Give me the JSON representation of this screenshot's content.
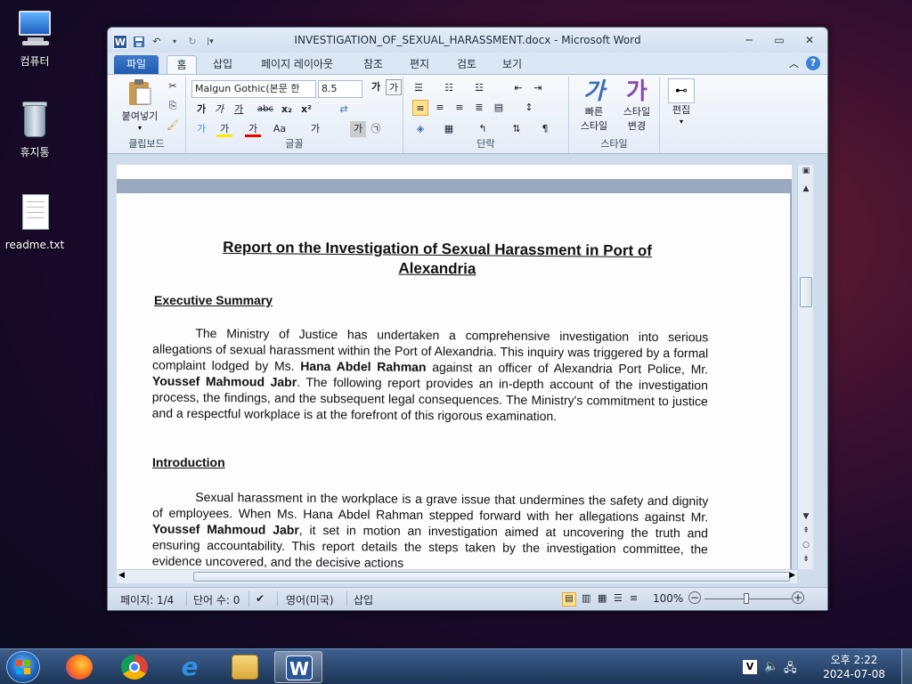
{
  "desktop": {
    "icons": [
      {
        "label": "컴퓨터"
      },
      {
        "label": "휴지통"
      },
      {
        "label": "readme.txt"
      }
    ]
  },
  "window": {
    "title": "INVESTIGATION_OF_SEXUAL_HARASSMENT.docx  -  Microsoft Word",
    "logo": "W",
    "controls": {
      "minimize": "─",
      "restore": "▭",
      "close": "✕"
    }
  },
  "tabs": {
    "file": "파일",
    "home": "홈",
    "insert": "삽입",
    "layout": "페이지 레이아웃",
    "references": "참조",
    "mailings": "편지",
    "review": "검토",
    "view": "보기",
    "help": "?"
  },
  "ribbon": {
    "clipboard": {
      "paste": "붙여넣기",
      "label": "클립보드"
    },
    "font": {
      "name": "Malgun Gothic(본문 한",
      "size": "8.5",
      "label": "글꼴",
      "bold": "가",
      "italic": "가",
      "underline": "가",
      "strike": "abc",
      "sub": "x₂",
      "sup": "x²",
      "highlight": "가",
      "color": "가",
      "case": "Aa",
      "grow": "가",
      "shrink": "가",
      "clear": "가",
      "phonetic": "가",
      "circle": "㉠"
    },
    "paragraph": {
      "label": "단락"
    },
    "styles": {
      "quick": "빠른\n스타일",
      "quick1": "빠른",
      "quick2": "스타일",
      "change1": "스타일",
      "change2": "변경",
      "label": "스타일",
      "glyph1": "가",
      "glyph2": "가"
    },
    "editing": {
      "label": "편집"
    }
  },
  "document": {
    "title_line1": "Report on the Investigation of Sexual Harassment in Port of",
    "title_line2": "Alexandria",
    "heading1": "Executive Summary",
    "para1_a": "The Ministry of Justice has undertaken a comprehensive investigation into serious allegations of sexual harassment within the Port of Alexandria. This inquiry was triggered by a formal complaint lodged by Ms. ",
    "para1_name1": "Hana Abdel Rahman",
    "para1_b": " against an officer of Alexandria Port Police, Mr. ",
    "para1_name2": "Youssef Mahmoud Jabr",
    "para1_c": ". The following report provides an in-depth account of the investigation process, the findings, and the subsequent legal consequences. The Ministry's commitment to justice and a respectful workplace is at the forefront of this rigorous examination.",
    "heading2": "Introduction",
    "para2_a": "Sexual harassment in the workplace is a grave issue that undermines the safety and dignity of employees. When Ms. Hana Abdel Rahman stepped forward with her allegations against Mr. ",
    "para2_name": "Youssef Mahmoud Jabr",
    "para2_b": ", it set in motion an investigation aimed at uncovering the truth and ensuring accountability. This report details the steps taken by the investigation committee, the evidence uncovered, and the decisive actions"
  },
  "status": {
    "page": "페이지: 1/4",
    "words": "단어 수: 0",
    "language": "영어(미국)",
    "mode": "삽입",
    "zoom": "100%"
  },
  "taskbar": {
    "time": "오후 2:22",
    "date": "2024-07-08"
  }
}
